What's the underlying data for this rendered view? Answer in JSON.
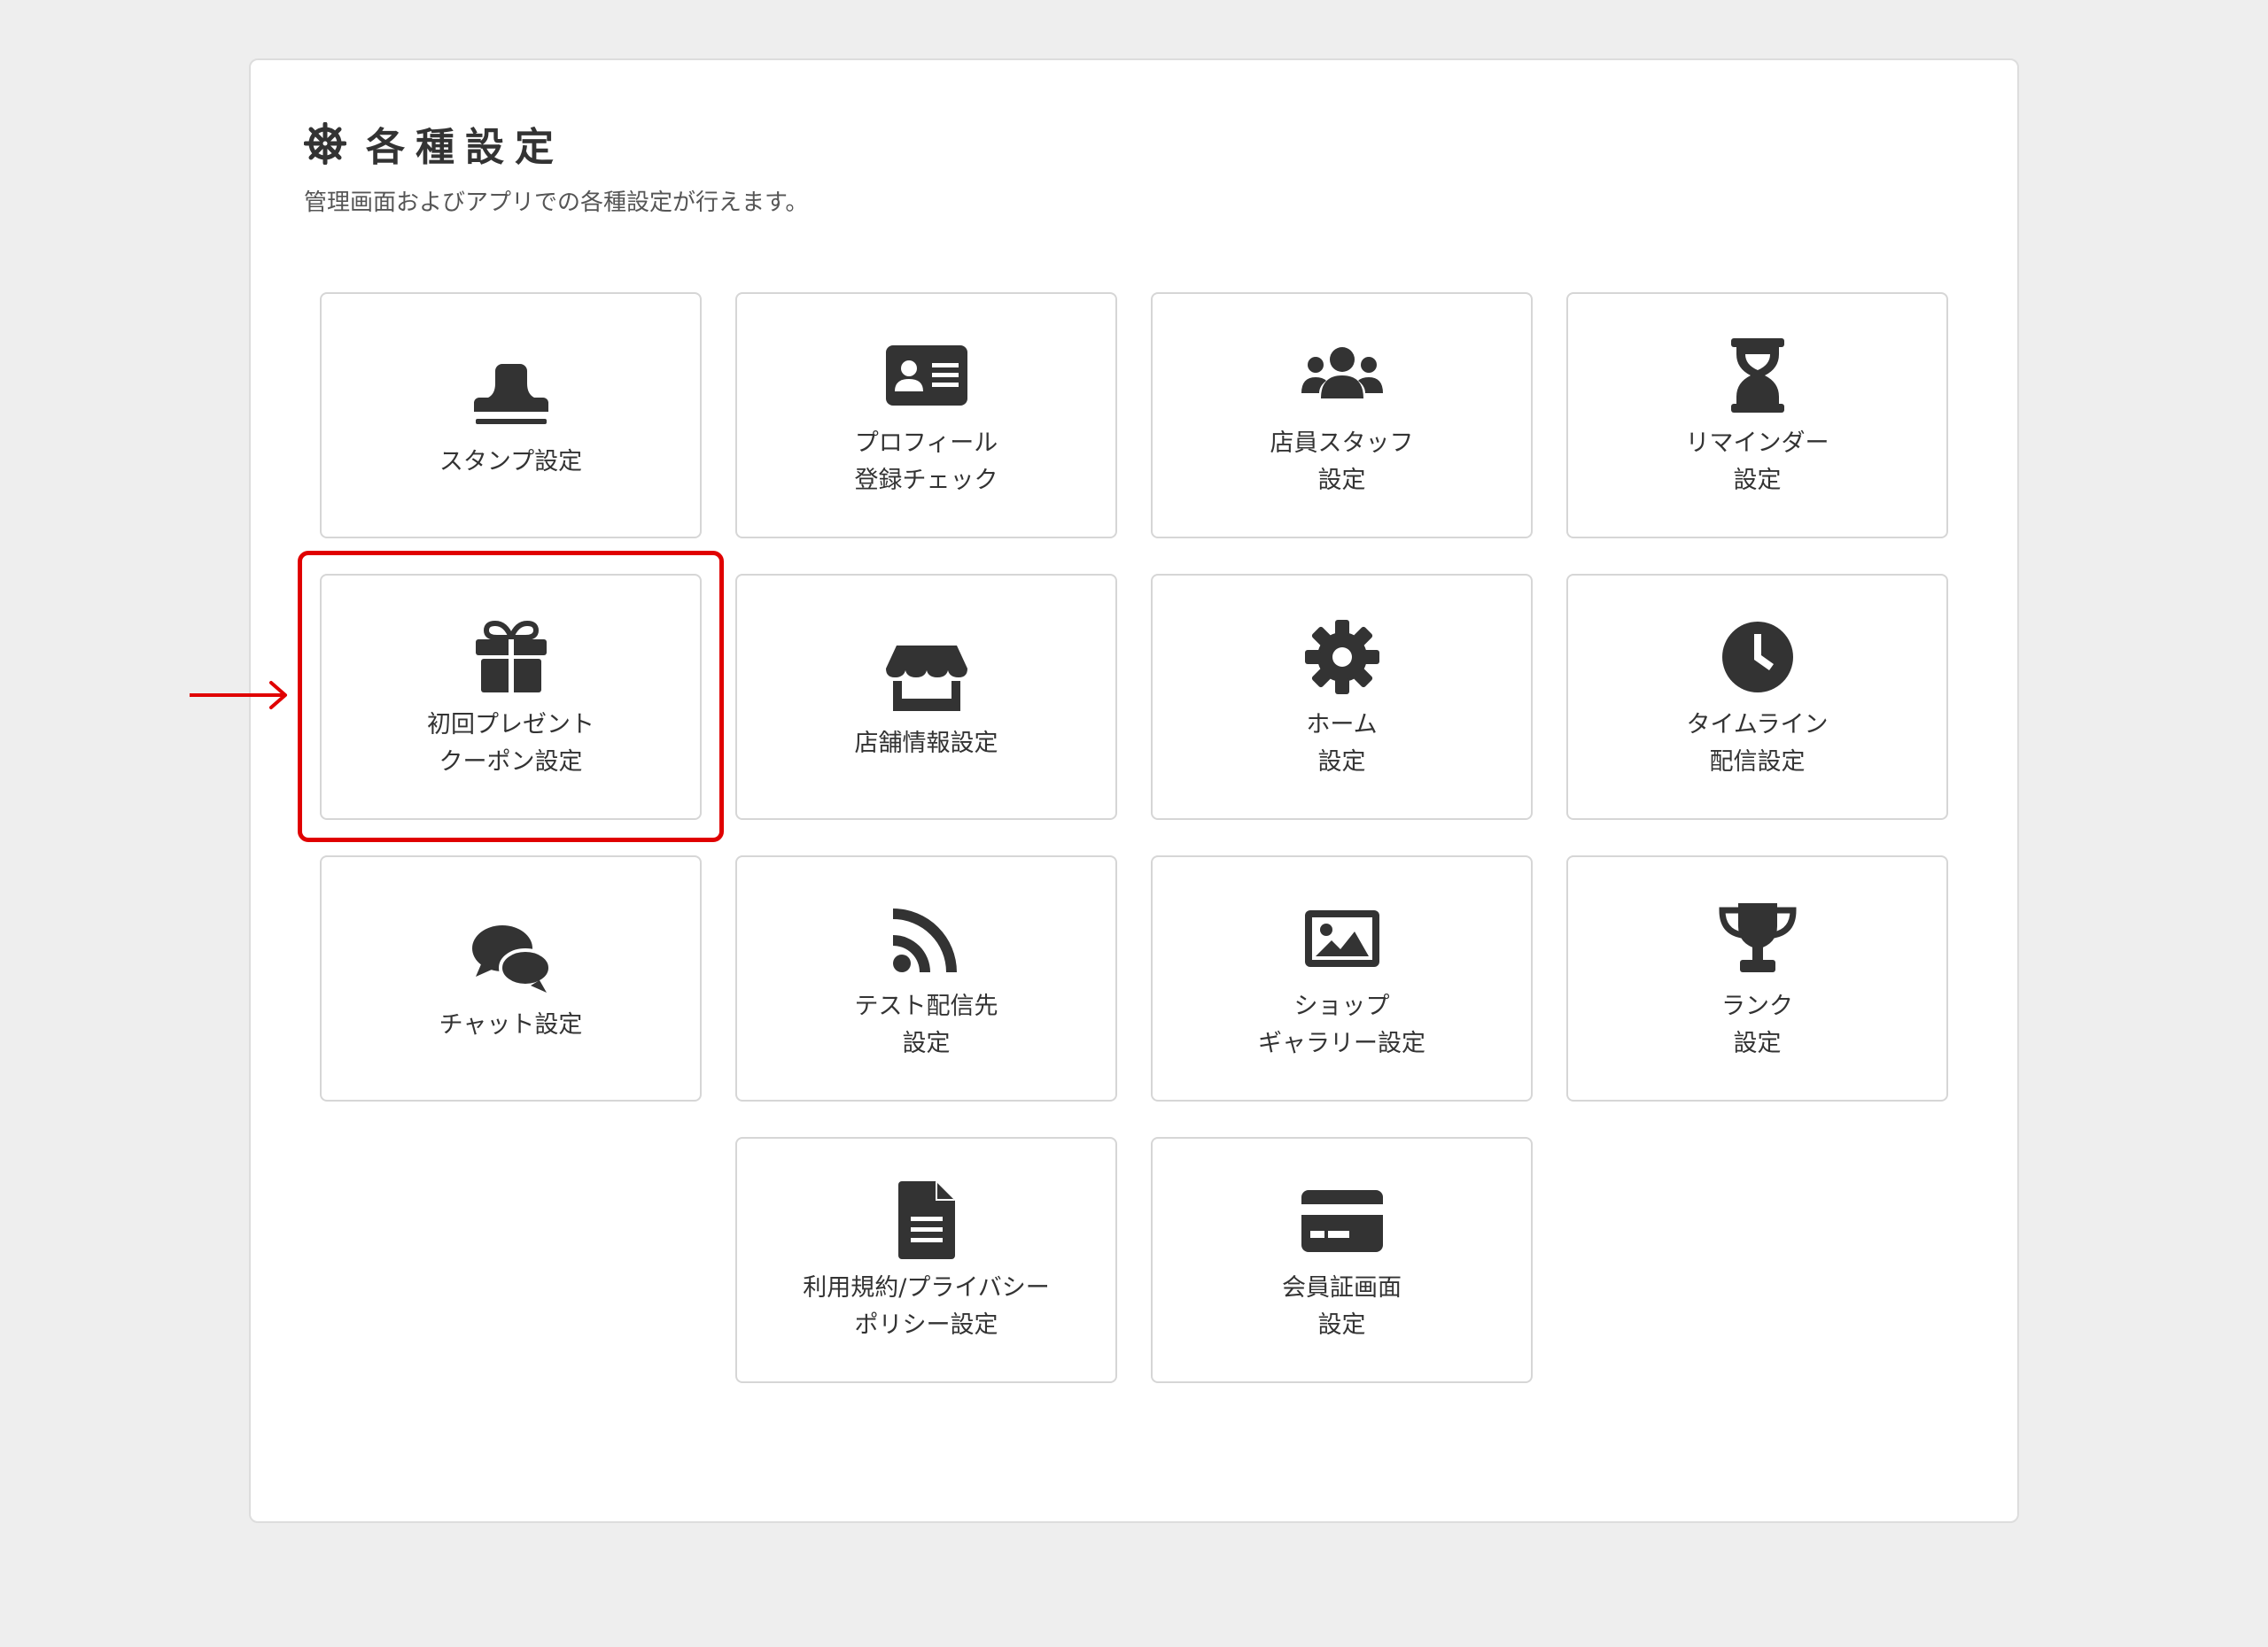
{
  "header": {
    "icon": "steering-wheel-icon",
    "title": "各種設定",
    "description": "管理画面およびアプリでの各種設定が行えます。"
  },
  "tiles": [
    {
      "icon": "stamp-icon",
      "line1": "スタンプ設定",
      "line2": ""
    },
    {
      "icon": "id-card-icon",
      "line1": "プロフィール",
      "line2": "登録チェック"
    },
    {
      "icon": "users-icon",
      "line1": "店員スタッフ",
      "line2": "設定"
    },
    {
      "icon": "hourglass-icon",
      "line1": "リマインダー",
      "line2": "設定"
    },
    {
      "icon": "gift-icon",
      "line1": "初回プレゼント",
      "line2": "クーポン設定"
    },
    {
      "icon": "store-icon",
      "line1": "店舗情報設定",
      "line2": ""
    },
    {
      "icon": "gear-icon",
      "line1": "ホーム",
      "line2": "設定"
    },
    {
      "icon": "clock-icon",
      "line1": "タイムライン",
      "line2": "配信設定"
    },
    {
      "icon": "chat-icon",
      "line1": "チャット設定",
      "line2": ""
    },
    {
      "icon": "rss-icon",
      "line1": "テスト配信先",
      "line2": "設定"
    },
    {
      "icon": "image-icon",
      "line1": "ショップ",
      "line2": "ギャラリー設定"
    },
    {
      "icon": "trophy-icon",
      "line1": "ランク",
      "line2": "設定"
    },
    {
      "icon": "document-icon",
      "line1": "利用規約/プライバシー",
      "line2": "ポリシー設定"
    },
    {
      "icon": "credit-card-icon",
      "line1": "会員証画面",
      "line2": "設定"
    }
  ],
  "annotation": {
    "highlight_color": "#e00000",
    "highlighted_tile": "初回プレゼント クーポン設定"
  },
  "colors": {
    "icon": "#333333",
    "background": "#eeeeee",
    "panel": "#ffffff"
  }
}
